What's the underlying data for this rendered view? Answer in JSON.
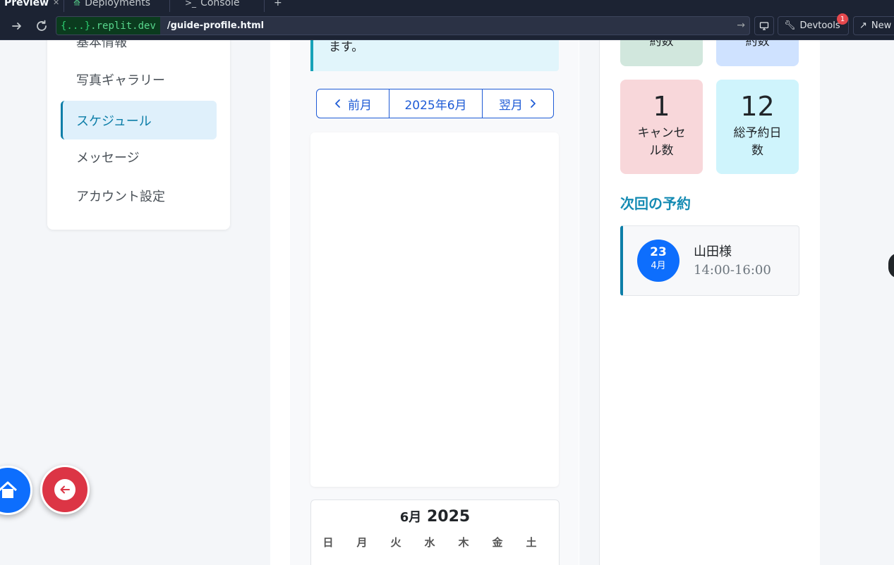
{
  "browser": {
    "tabs": [
      {
        "label": "Preview"
      },
      {
        "label": "Deployments"
      },
      {
        "label": "Console"
      }
    ],
    "url_domain_prefix": "{...}",
    "url_domain_suffix": ".replit.dev",
    "url_path": "/guide-profile.html",
    "devtools_label": "Devtools",
    "devtools_badge": "1",
    "new_tab_label": "New"
  },
  "sidebar": {
    "items": [
      {
        "label": "基本情報",
        "active": false
      },
      {
        "label": "写真ギャラリー",
        "active": false
      },
      {
        "label": "スケジュール",
        "active": true
      },
      {
        "label": "メッセージ",
        "active": false
      },
      {
        "label": "アカウント設定",
        "active": false
      }
    ]
  },
  "schedule": {
    "alert_text": "ます。",
    "prev_month_label": "前月",
    "current_month_label": "2025年6月",
    "next_month_label": "翌月",
    "mini_calendar": {
      "month": "6月",
      "year": "2025",
      "weekdays": [
        "日",
        "月",
        "火",
        "水",
        "木",
        "金",
        "土"
      ]
    }
  },
  "stats": {
    "top_left_label": "約数",
    "top_right_label": "約数",
    "cancel_count": "1",
    "cancel_label": "キャンセル数",
    "total_days_count": "12",
    "total_days_label": "総予約日数"
  },
  "next_reservation": {
    "title": "次回の予約",
    "day": "23",
    "month": "4月",
    "name": "山田様",
    "time": "14:00-16:00"
  },
  "colors": {
    "accent": "#0d7ea8",
    "primary": "#0d6efd",
    "danger": "#dc3545"
  }
}
